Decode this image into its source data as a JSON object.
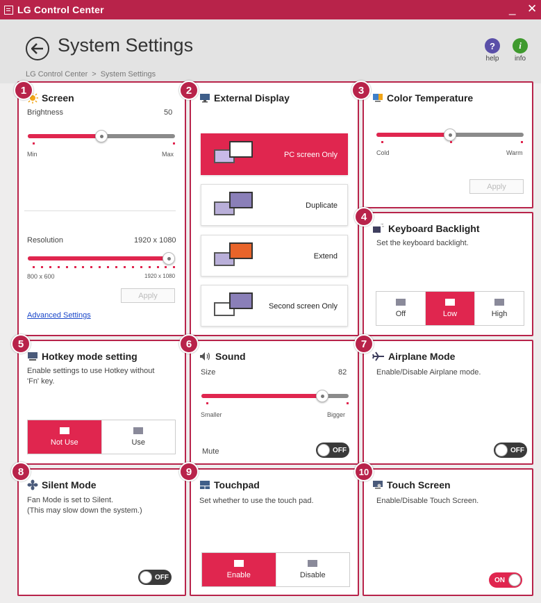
{
  "window": {
    "title": "LG Control Center",
    "minimize": "_",
    "close": "✕"
  },
  "header": {
    "title": "System Settings",
    "help_label": "help",
    "info_label": "info"
  },
  "breadcrumb": [
    "LG Control Center",
    ">",
    "System Settings"
  ],
  "colors": {
    "accent": "#e0264f",
    "titlebar": "#b8234a",
    "border": "#b8234a"
  },
  "cards": {
    "screen": {
      "badge": "1",
      "title": "Screen",
      "brightness_label": "Brightness",
      "brightness_value": "50",
      "brightness_fraction": 0.5,
      "min": "Min",
      "max": "Max",
      "resolution_label": "Resolution",
      "resolution_value": "1920 x 1080",
      "res_min": "800 x 600",
      "res_max": "1920 x 1080",
      "apply": "Apply",
      "advanced": "Advanced Settings"
    },
    "external": {
      "badge": "2",
      "title": "External Display",
      "options": [
        "PC screen Only",
        "Duplicate",
        "Extend",
        "Second screen Only"
      ],
      "selected": "PC screen Only"
    },
    "color": {
      "badge": "3",
      "title": "Color Temperature",
      "cold": "Cold",
      "warm": "Warm",
      "apply": "Apply",
      "fraction": 0.5
    },
    "keyboard": {
      "badge": "4",
      "title": "Keyboard Backlight",
      "desc": "Set the keyboard backlight.",
      "options": [
        "Off",
        "Low",
        "High"
      ],
      "selected": "Low"
    },
    "hotkey": {
      "badge": "5",
      "title": "Hotkey mode setting",
      "desc1": "Enable settings to use Hotkey without",
      "desc2": "'Fn' key.",
      "options": [
        "Not Use",
        "Use"
      ],
      "selected": "Not Use"
    },
    "sound": {
      "badge": "6",
      "title": "Sound",
      "size_label": "Size",
      "size_value": "82",
      "fraction": 0.82,
      "smaller": "Smaller",
      "bigger": "Bigger",
      "mute_label": "Mute",
      "mute_state": "OFF"
    },
    "airplane": {
      "badge": "7",
      "title": "Airplane Mode",
      "desc": "Enable/Disable Airplane mode.",
      "state": "OFF"
    },
    "silent": {
      "badge": "8",
      "title": "Silent Mode",
      "desc1": "Fan Mode is set to Silent.",
      "desc2": "(This may slow down the system.)",
      "state": "OFF"
    },
    "touchpad": {
      "badge": "9",
      "title": "Touchpad",
      "desc": "Set whether to use the touch pad.",
      "options": [
        "Enable",
        "Disable"
      ],
      "selected": "Enable"
    },
    "touchscreen": {
      "badge": "10",
      "title": "Touch Screen",
      "desc": "Enable/Disable Touch Screen.",
      "state": "ON"
    }
  }
}
